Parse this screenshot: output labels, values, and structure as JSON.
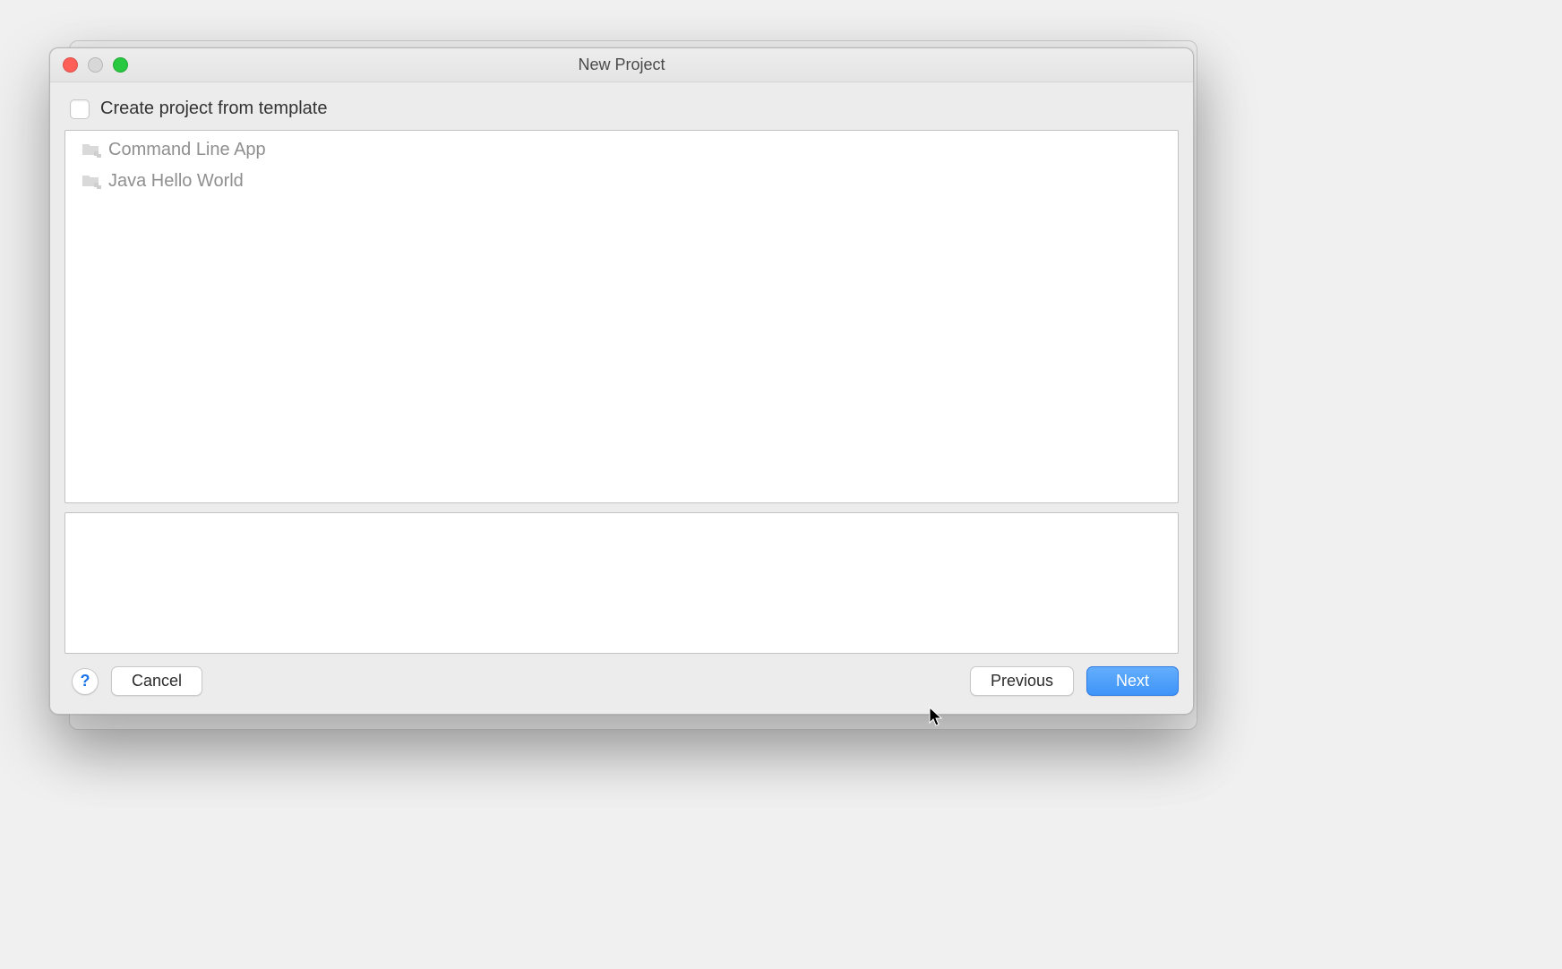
{
  "window": {
    "title": "New Project"
  },
  "template_checkbox": {
    "label": "Create project from template",
    "checked": false
  },
  "templates": [
    {
      "icon": "folder-icon",
      "label": "Command Line App"
    },
    {
      "icon": "folder-icon",
      "label": "Java Hello World"
    }
  ],
  "buttons": {
    "help": "?",
    "cancel": "Cancel",
    "previous": "Previous",
    "next": "Next"
  }
}
